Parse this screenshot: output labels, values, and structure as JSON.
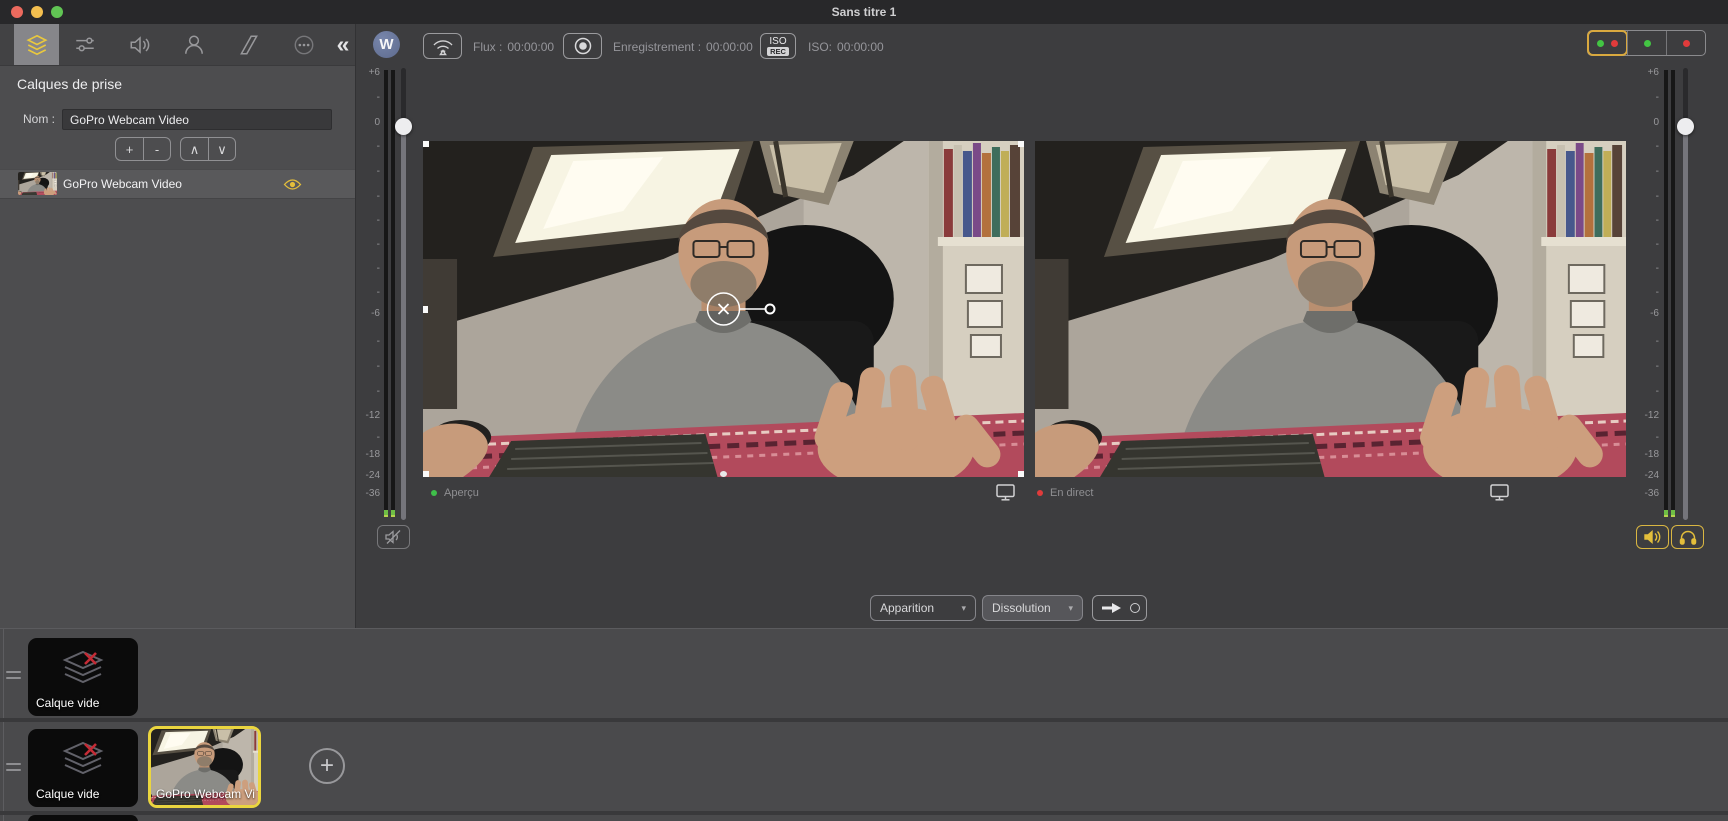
{
  "window": {
    "title": "Sans titre 1"
  },
  "tabs": {
    "collapse_glyph": "«"
  },
  "left_panel": {
    "title": "Calques de prise",
    "name_label": "Nom :",
    "name_value": "GoPro Webcam Video",
    "add": "+",
    "remove": "-",
    "up": "∧",
    "down": "∨",
    "layer_label": "GoPro Webcam Video"
  },
  "toolbar": {
    "logo_letter": "W",
    "stream_label": "Flux :",
    "stream_time": "00:00:00",
    "record_label": "Enregistrement :",
    "record_time": "00:00:00",
    "iso_label": "ISO:",
    "iso_time": "00:00:00",
    "iso_btn_top": "ISO",
    "iso_btn_bottom": "REC"
  },
  "meters": {
    "scale": [
      "+6",
      "-",
      "0",
      "-",
      "-",
      "-",
      "-",
      "-",
      "-",
      "-",
      "-6",
      "-",
      "-",
      "-",
      "-12",
      "-",
      "-18",
      "-24",
      "-36"
    ]
  },
  "monitors": {
    "preview_label": "Aperçu",
    "live_label": "En direct"
  },
  "transitions": {
    "first": "Apparition",
    "second": "Dissolution",
    "caret": "▾"
  },
  "layers_panel": {
    "row1_clip1_label": "Calque vide",
    "row2_clip1_label": "Calque vide",
    "row2_clip2_label": "GoPro Webcam Vi",
    "add_glyph": "+"
  },
  "colors": {
    "accent_yellow": "#E9C83E",
    "selection_yellow": "#EAD53F",
    "status_green": "#3FBF4A",
    "status_red": "#E03B3B",
    "record_red": "#E0202E",
    "traffic_red": "#EC6A5E",
    "traffic_yellow": "#F4BF4F",
    "traffic_green": "#61C554"
  }
}
